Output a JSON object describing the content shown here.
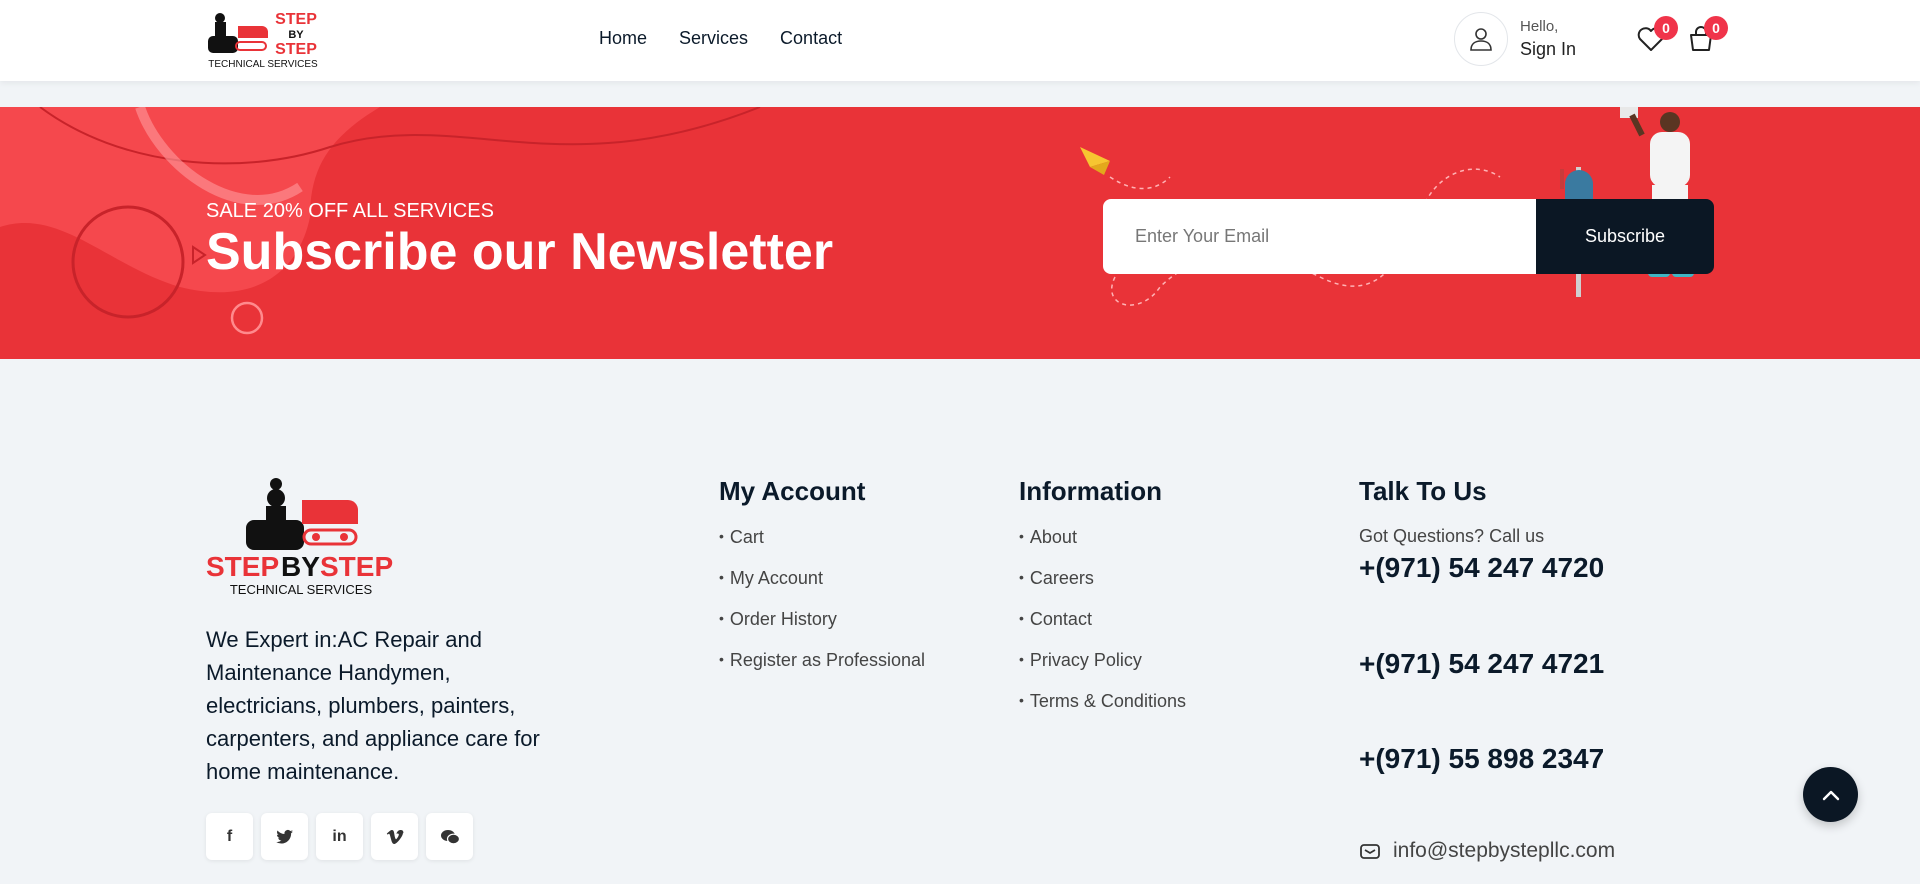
{
  "brand": {
    "line1": "STEP",
    "line2": "BY",
    "line3": "STEP",
    "tagline": "TECHNICAL SERVICES",
    "full_name_part1": "STEP",
    "full_name_part2": "BY",
    "full_name_part3": "STEP",
    "colors": {
      "red": "#e93338",
      "black": "#111111"
    }
  },
  "nav": [
    {
      "label": "Home"
    },
    {
      "label": "Services"
    },
    {
      "label": "Contact"
    }
  ],
  "user": {
    "greeting": "Hello,",
    "signin": "Sign In"
  },
  "wishlist": {
    "icon": "heart-icon",
    "count": "0"
  },
  "cart": {
    "icon": "shopping-bag-icon",
    "count": "0"
  },
  "newsletter": {
    "sale": "SALE 20% OFF ALL SERVICES",
    "title": "Subscribe our Newsletter",
    "email_placeholder": "Enter Your Email",
    "email_value": "",
    "button": "Subscribe",
    "bg_color": "#e93338"
  },
  "footer": {
    "about": "We Expert in:AC Repair and Maintenance Handymen, electricians, plumbers, painters, carpenters, and appliance care for home maintenance.",
    "socials": [
      {
        "icon": "facebook-icon",
        "glyph": "f"
      },
      {
        "icon": "twitter-icon",
        "glyph": "t"
      },
      {
        "icon": "linkedin-icon",
        "glyph": "in"
      },
      {
        "icon": "vimeo-icon",
        "glyph": "v"
      },
      {
        "icon": "wechat-icon",
        "glyph": "wc"
      }
    ],
    "my_account": {
      "title": "My Account",
      "links": [
        "Cart",
        "My Account",
        "Order History",
        "Register as Professional"
      ]
    },
    "information": {
      "title": "Information",
      "links": [
        "About",
        "Careers",
        "Contact",
        "Privacy Policy",
        "Terms & Conditions"
      ]
    },
    "talk": {
      "title": "Talk To Us",
      "subtitle": "Got Questions? Call us",
      "phones": [
        "+(971) 54 247 4720",
        "+(971) 54 247 4721",
        "+(971) 55 898 2347"
      ],
      "email": "info@stepbystepllc.com"
    }
  }
}
